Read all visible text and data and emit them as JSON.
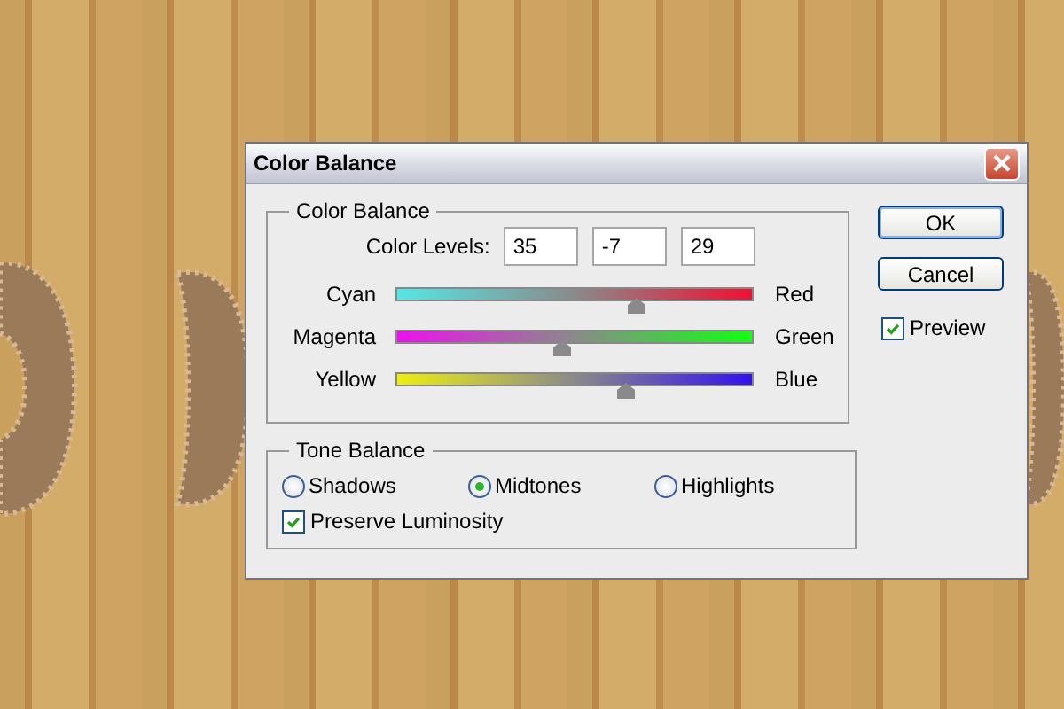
{
  "window": {
    "title": "Color Balance"
  },
  "color_balance": {
    "title": "Color Balance",
    "levels_label": "Color Levels:",
    "levels": [
      "35",
      "-7",
      "29"
    ],
    "sliders": [
      {
        "left": "Cyan",
        "right": "Red",
        "level": 0.675
      },
      {
        "left": "Magenta",
        "right": "Green",
        "level": 0.465
      },
      {
        "left": "Yellow",
        "right": "Blue",
        "level": 0.645
      }
    ]
  },
  "tone_balance": {
    "title": "Tone Balance",
    "options": [
      {
        "label": "Shadows",
        "selected": false
      },
      {
        "label": "Midtones",
        "selected": true
      },
      {
        "label": "Highlights",
        "selected": false
      }
    ],
    "preserve_luminosity": {
      "label": "Preserve Luminosity",
      "checked": true
    }
  },
  "buttons": [
    {
      "label": "OK",
      "default": true
    },
    {
      "label": "Cancel",
      "default": false
    }
  ],
  "preview": {
    "label": "Preview",
    "checked": true
  }
}
